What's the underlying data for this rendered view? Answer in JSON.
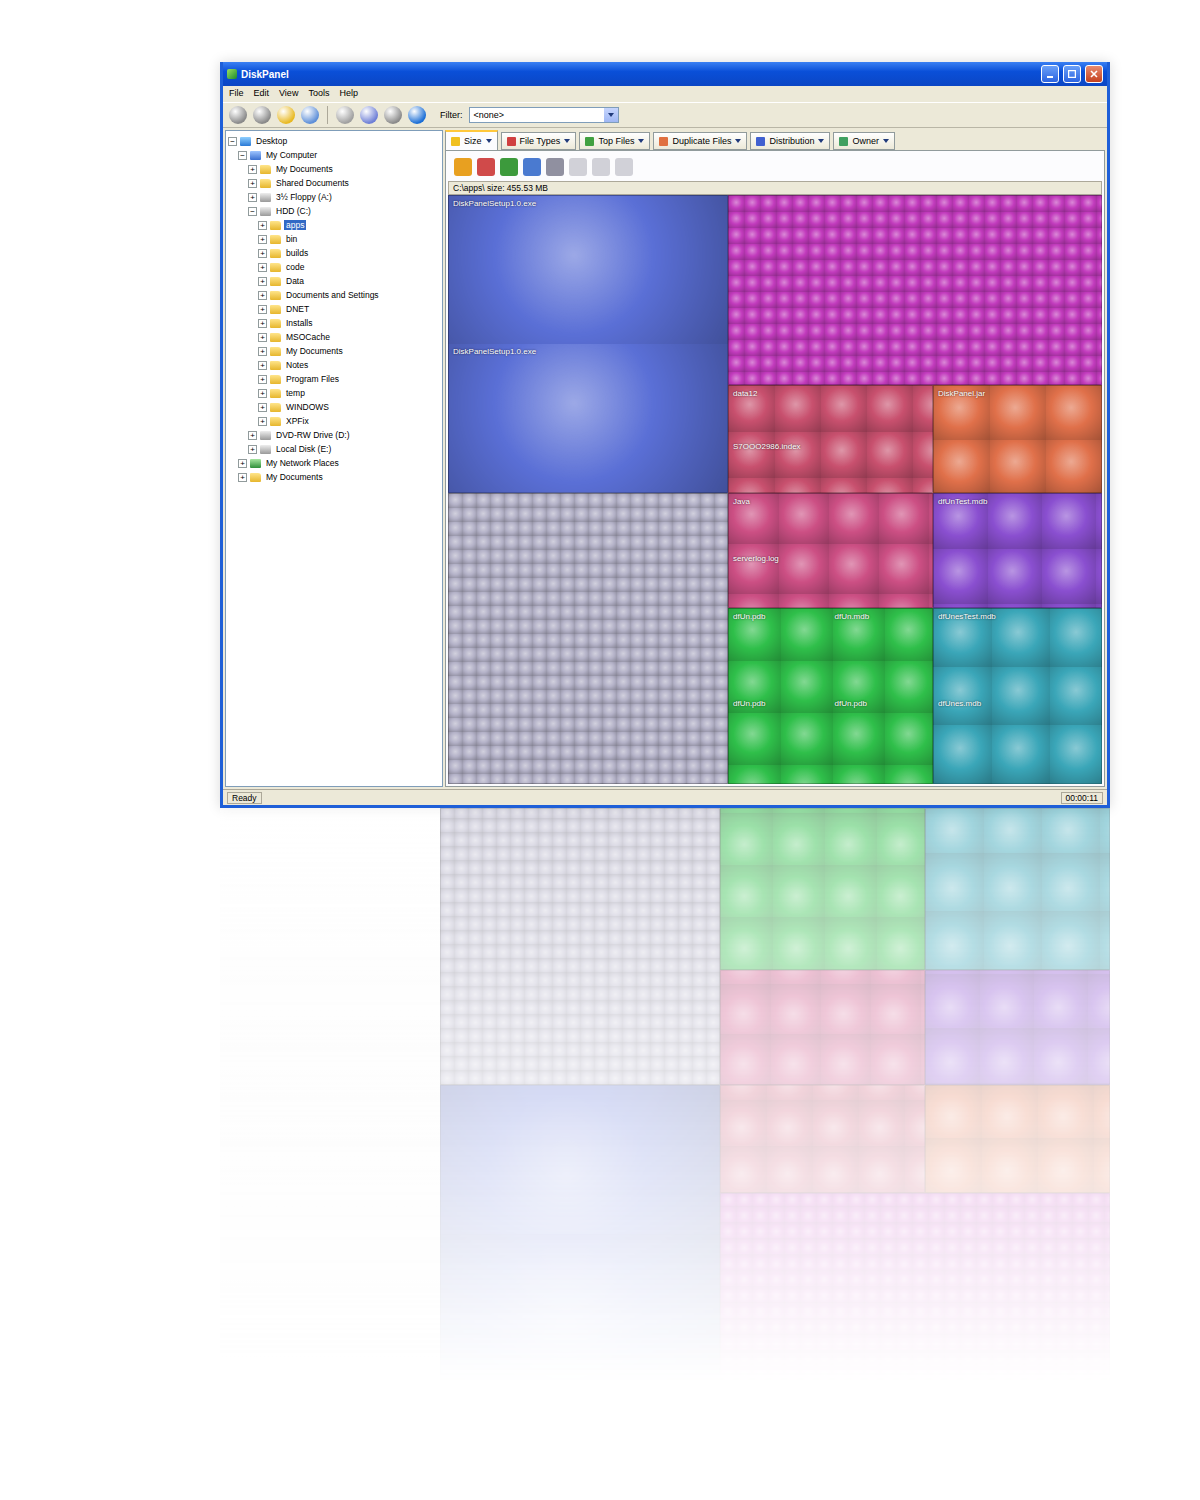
{
  "window": {
    "title": "DiskPanel"
  },
  "menu": [
    "File",
    "Edit",
    "View",
    "Tools",
    "Help"
  ],
  "filter": {
    "label": "Filter:",
    "value": "<none>"
  },
  "tabs": [
    {
      "label": "Size",
      "selected": true
    },
    {
      "label": "File Types",
      "selected": false
    },
    {
      "label": "Top Files",
      "selected": false
    },
    {
      "label": "Duplicate Files",
      "selected": false
    },
    {
      "label": "Distribution",
      "selected": false
    },
    {
      "label": "Owner",
      "selected": false
    }
  ],
  "path_bar": "C:\\apps\\  size: 455.53 MB",
  "tree": [
    {
      "label": "Desktop",
      "depth": 0,
      "toggle": "−",
      "kind": "desktop",
      "selected": false
    },
    {
      "label": "My Computer",
      "depth": 1,
      "toggle": "−",
      "kind": "computer",
      "selected": false
    },
    {
      "label": "My Documents",
      "depth": 2,
      "toggle": "+",
      "kind": "folder",
      "selected": false
    },
    {
      "label": "Shared Documents",
      "depth": 2,
      "toggle": "+",
      "kind": "folder",
      "selected": false
    },
    {
      "label": "3½ Floppy (A:)",
      "depth": 2,
      "toggle": "+",
      "kind": "drive",
      "selected": false
    },
    {
      "label": "HDD (C:)",
      "depth": 2,
      "toggle": "−",
      "kind": "drive",
      "selected": false
    },
    {
      "label": "apps",
      "depth": 3,
      "toggle": "+",
      "kind": "folder",
      "selected": true
    },
    {
      "label": "bin",
      "depth": 3,
      "toggle": "+",
      "kind": "folder",
      "selected": false
    },
    {
      "label": "builds",
      "depth": 3,
      "toggle": "+",
      "kind": "folder",
      "selected": false
    },
    {
      "label": "code",
      "depth": 3,
      "toggle": "+",
      "kind": "folder",
      "selected": false
    },
    {
      "label": "Data",
      "depth": 3,
      "toggle": "+",
      "kind": "folder",
      "selected": false
    },
    {
      "label": "Documents and Settings",
      "depth": 3,
      "toggle": "+",
      "kind": "folder",
      "selected": false
    },
    {
      "label": "DNET",
      "depth": 3,
      "toggle": "+",
      "kind": "folder",
      "selected": false
    },
    {
      "label": "Installs",
      "depth": 3,
      "toggle": "+",
      "kind": "folder",
      "selected": false
    },
    {
      "label": "MSOCache",
      "depth": 3,
      "toggle": "+",
      "kind": "folder",
      "selected": false
    },
    {
      "label": "My Documents",
      "depth": 3,
      "toggle": "+",
      "kind": "folder",
      "selected": false
    },
    {
      "label": "Notes",
      "depth": 3,
      "toggle": "+",
      "kind": "folder",
      "selected": false
    },
    {
      "label": "Program Files",
      "depth": 3,
      "toggle": "+",
      "kind": "folder",
      "selected": false
    },
    {
      "label": "temp",
      "depth": 3,
      "toggle": "+",
      "kind": "folder",
      "selected": false
    },
    {
      "label": "WINDOWS",
      "depth": 3,
      "toggle": "+",
      "kind": "folder",
      "selected": false
    },
    {
      "label": "XPFix",
      "depth": 3,
      "toggle": "+",
      "kind": "folder",
      "selected": false
    },
    {
      "label": "DVD-RW Drive (D:)",
      "depth": 2,
      "toggle": "+",
      "kind": "drive",
      "selected": false
    },
    {
      "label": "Local Disk (E:)",
      "depth": 2,
      "toggle": "+",
      "kind": "drive",
      "selected": false
    },
    {
      "label": "My Network Places",
      "depth": 1,
      "toggle": "+",
      "kind": "network",
      "selected": false
    },
    {
      "label": "My Documents",
      "depth": 1,
      "toggle": "+",
      "kind": "folder",
      "selected": false
    }
  ],
  "treemap": [
    {
      "labels": [
        "DiskPanelSetup1.0.exe",
        "DiskPanelSetup1.0.exe"
      ],
      "color": "#5a6fd6"
    },
    {
      "labels": [],
      "color": "#b4b2c8"
    },
    {
      "labels": [],
      "color": "#c23bbd"
    },
    {
      "labels": [
        "data12",
        "S7OOO2986.index"
      ],
      "color": "#c8506e"
    },
    {
      "labels": [
        "DiskPanel.jar"
      ],
      "color": "#e0704a"
    },
    {
      "labels": [
        "Java",
        "serverlog.log"
      ],
      "color": "#cc4f84"
    },
    {
      "labels": [
        "dfUnTest.mdb"
      ],
      "color": "#8a4fd0"
    },
    {
      "labels": [
        "dfUn.pdb",
        "dfUn.mdb",
        "dfUn.pdb",
        "dfUn.pdb"
      ],
      "color": "#2fbf4a"
    },
    {
      "labels": [
        "dfUnesTest.mdb",
        "dfUnes.mdb"
      ],
      "color": "#3aa6b8"
    }
  ],
  "status_bar": {
    "left": "Ready",
    "right": "00:00:11"
  }
}
